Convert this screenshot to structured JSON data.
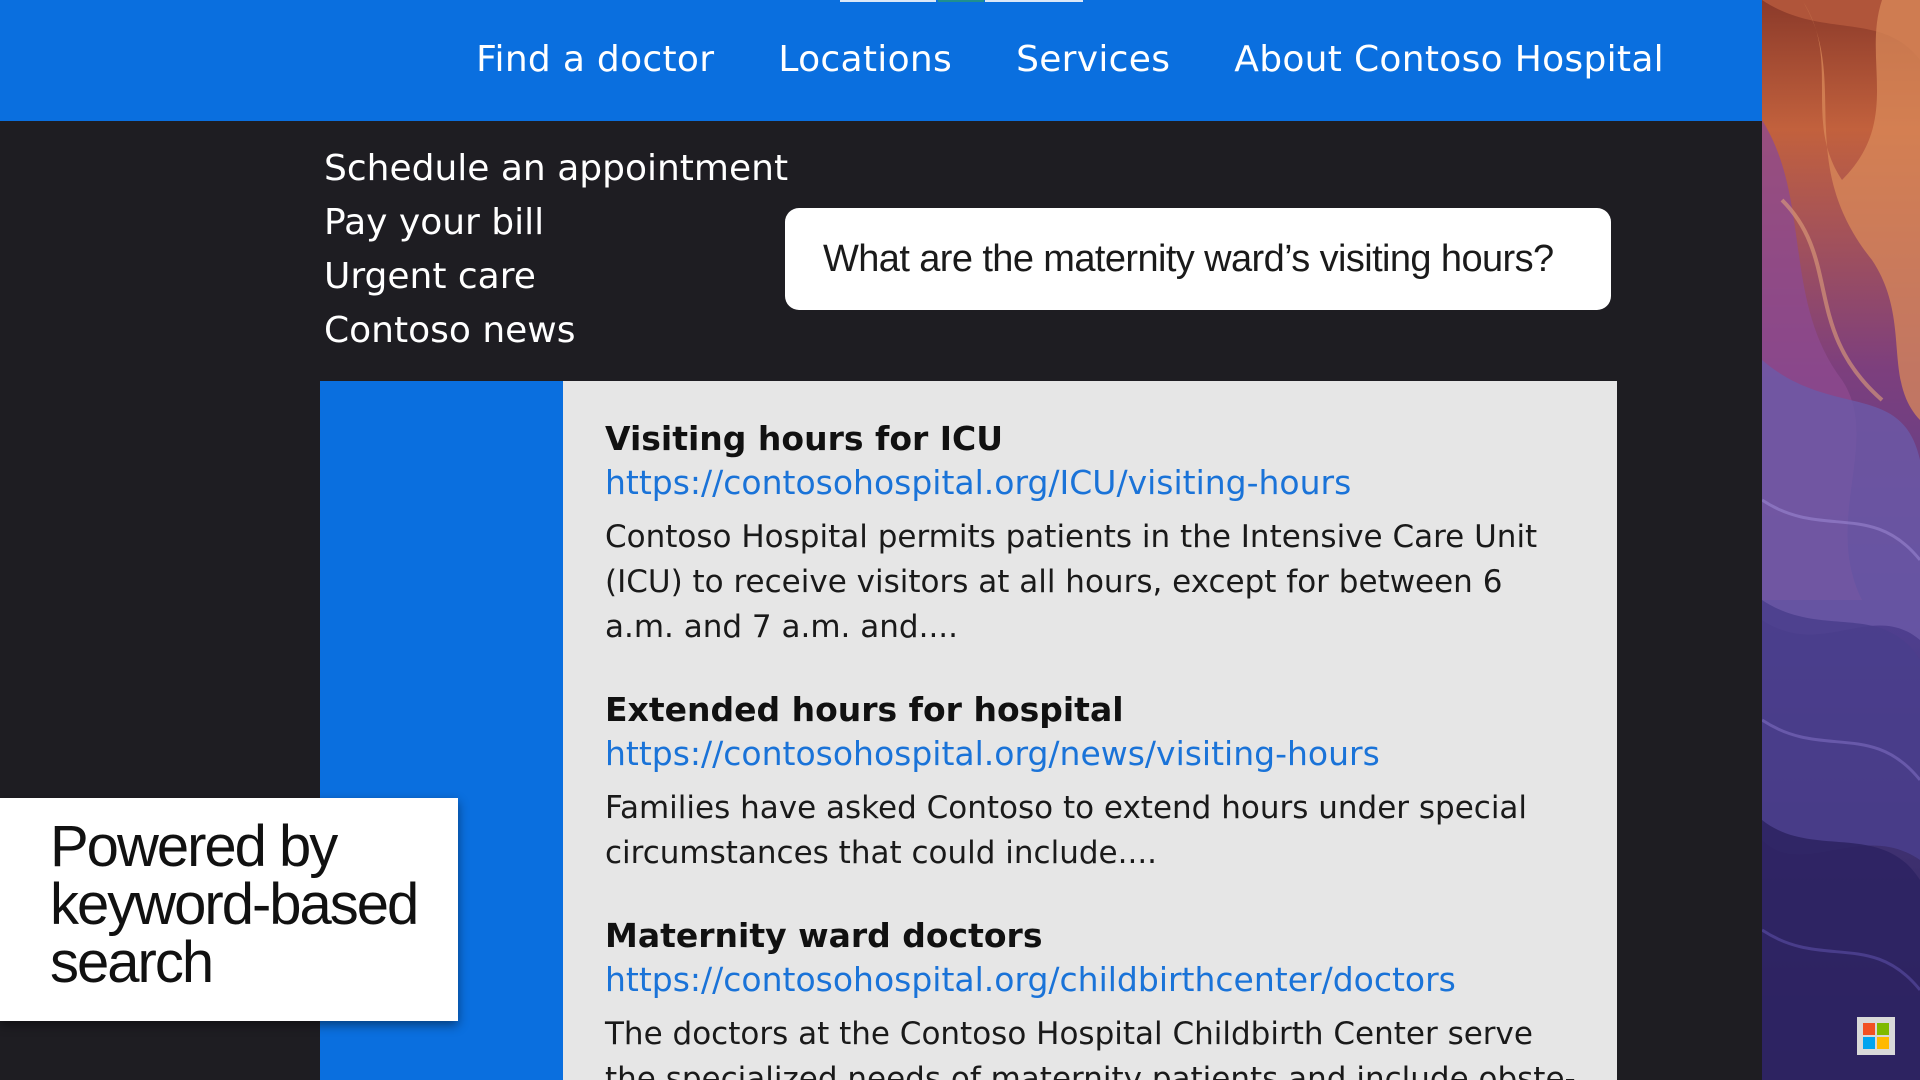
{
  "nav": {
    "items": [
      {
        "label": "Find a doctor"
      },
      {
        "label": "Locations"
      },
      {
        "label": "Services"
      },
      {
        "label": "About Contoso Hospital"
      }
    ]
  },
  "quick_links": [
    {
      "label": "Schedule an appointment"
    },
    {
      "label": "Pay your bill"
    },
    {
      "label": "Urgent care"
    },
    {
      "label": "Contoso news"
    }
  ],
  "search": {
    "value": "What are the maternity ward’s visiting hours?"
  },
  "results": [
    {
      "title": "Visiting hours for ICU",
      "url": "https://contosohospital.org/ICU/visiting-hours",
      "description": "Contoso Hospital permits patients in the Intensive Care Unit (ICU) to receive visitors at all hours, except for between 6 a.m. and 7 a.m. and...."
    },
    {
      "title": "Extended hours for hospital",
      "url": "https://contosohospital.org/news/visiting-hours",
      "description": "Families have asked Contoso to extend hours under special circumstances that could include...."
    },
    {
      "title": "Maternity ward doctors",
      "url": "https://contosohospital.org/childbirthcenter/doctors",
      "description": "The doctors at the Contoso Hospital Childbirth Center serve the specialized needs of maternity patients and include obste-"
    }
  ],
  "caption": {
    "text": "Powered by keyword-based search"
  },
  "colors": {
    "brand_blue": "#0a6fdf",
    "link_blue": "#1a73d8",
    "page_dark": "#1e1d22",
    "results_bg": "#e6e6e6"
  },
  "icons": {
    "logo": "four-square-logo-icon"
  }
}
